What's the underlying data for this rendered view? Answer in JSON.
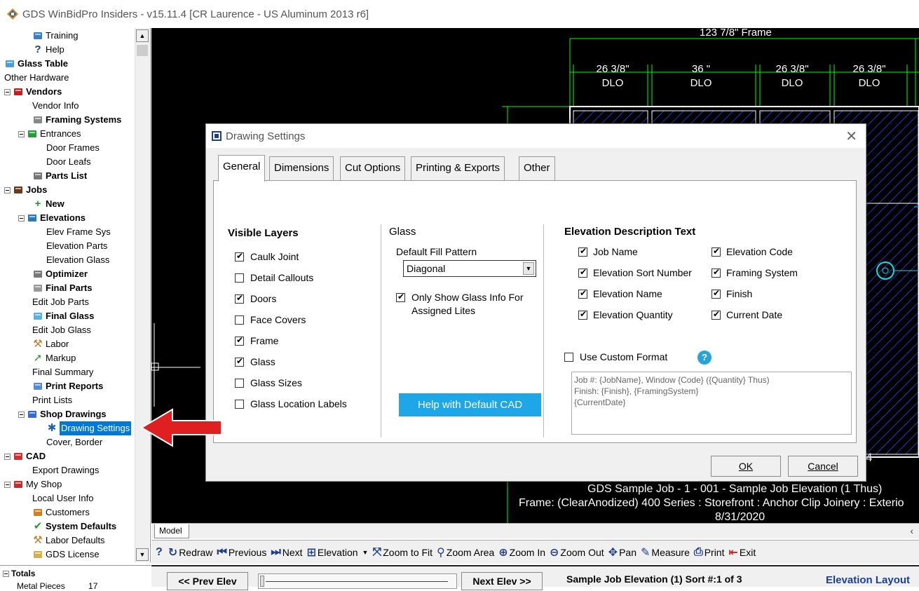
{
  "window": {
    "title": "GDS WinBidPro Insiders - v15.11.4  [CR Laurence - US Aluminum 2013 r6]"
  },
  "tree": {
    "items": [
      {
        "label": "Training",
        "bold": false,
        "icon": "training-icon"
      },
      {
        "label": "Help",
        "bold": false,
        "icon": "help-icon"
      },
      {
        "label": "Glass Table",
        "bold": true,
        "icon": "glass-table-icon"
      },
      {
        "label": "Other Hardware",
        "bold": false,
        "icon": ""
      },
      {
        "label": "Vendors",
        "bold": true,
        "icon": "vendors-icon"
      },
      {
        "label": "Vendor Info",
        "bold": false,
        "icon": ""
      },
      {
        "label": "Framing Systems",
        "bold": true,
        "icon": "framing-systems-icon"
      },
      {
        "label": "Entrances",
        "bold": false,
        "icon": "entrances-icon"
      },
      {
        "label": "Door Frames",
        "bold": false,
        "icon": ""
      },
      {
        "label": "Door Leafs",
        "bold": false,
        "icon": ""
      },
      {
        "label": "Parts List",
        "bold": true,
        "icon": "parts-list-icon"
      },
      {
        "label": "Jobs",
        "bold": true,
        "icon": "jobs-icon"
      },
      {
        "label": "New",
        "bold": true,
        "icon": "new-icon"
      },
      {
        "label": "Elevations",
        "bold": true,
        "icon": "elevations-icon"
      },
      {
        "label": "Elev Frame Sys",
        "bold": false,
        "icon": ""
      },
      {
        "label": "Elevation Parts",
        "bold": false,
        "icon": ""
      },
      {
        "label": "Elevation Glass",
        "bold": false,
        "icon": ""
      },
      {
        "label": "Optimizer",
        "bold": true,
        "icon": "optimizer-icon"
      },
      {
        "label": "Final Parts",
        "bold": true,
        "icon": "final-parts-icon"
      },
      {
        "label": "Edit Job Parts",
        "bold": false,
        "icon": ""
      },
      {
        "label": "Final Glass",
        "bold": true,
        "icon": "final-glass-icon"
      },
      {
        "label": "Edit Job Glass",
        "bold": false,
        "icon": ""
      },
      {
        "label": "Labor",
        "bold": false,
        "icon": "labor-icon"
      },
      {
        "label": "Markup",
        "bold": false,
        "icon": "markup-icon"
      },
      {
        "label": "Final Summary",
        "bold": false,
        "icon": ""
      },
      {
        "label": "Print Reports",
        "bold": true,
        "icon": "print-reports-icon"
      },
      {
        "label": "Print Lists",
        "bold": false,
        "icon": ""
      },
      {
        "label": "Shop Drawings",
        "bold": true,
        "icon": "shop-drawings-icon"
      },
      {
        "label": "Drawing Settings",
        "bold": false,
        "icon": "gear-icon",
        "selected": true
      },
      {
        "label": "Cover, Border",
        "bold": false,
        "icon": ""
      },
      {
        "label": "CAD",
        "bold": true,
        "icon": "cad-icon"
      },
      {
        "label": "Export Drawings",
        "bold": false,
        "icon": ""
      },
      {
        "label": "My Shop",
        "bold": false,
        "icon": "my-shop-icon"
      },
      {
        "label": "Local User Info",
        "bold": false,
        "icon": ""
      },
      {
        "label": "Customers",
        "bold": false,
        "icon": "customers-icon"
      },
      {
        "label": "System Defaults",
        "bold": true,
        "icon": "checkmark-icon"
      },
      {
        "label": "Labor Defaults",
        "bold": false,
        "icon": "labor-defaults-icon"
      },
      {
        "label": "GDS License",
        "bold": false,
        "icon": "license-icon"
      }
    ],
    "totals_label": "Totals",
    "totals_row_label": "Metal Pieces",
    "totals_row_value": "17"
  },
  "cad": {
    "frame_dim": "123 7/8\" Frame",
    "dlo": [
      {
        "dim": "26 3/8\"",
        "label": "DLO"
      },
      {
        "dim": "36 \"",
        "label": "DLO"
      },
      {
        "dim": "26 3/8\"",
        "label": "DLO"
      },
      {
        "dim": "26 3/8\"",
        "label": "DLO"
      }
    ],
    "right_digit": "4",
    "desc_line1": "GDS Sample Job - 1 - 001 - Sample Job Elevation (1 Thus)",
    "desc_line2": "Frame: (ClearAnodized) 400 Series : Storefront : Anchor Clip Joinery : Exterio",
    "desc_line3": "8/31/2020"
  },
  "model_tab": "Model",
  "toolbar": {
    "help": "?",
    "redraw": "Redraw",
    "previous": "Previous",
    "next": "Next",
    "elevation": "Elevation",
    "zoom_fit": "Zoom to Fit",
    "zoom_area": "Zoom Area",
    "zoom_in": "Zoom In",
    "zoom_out": "Zoom Out",
    "pan": "Pan",
    "measure": "Measure",
    "print": "Print",
    "exit": "Exit"
  },
  "navbar": {
    "prev": "<< Prev Elev",
    "next": "Next Elev >>",
    "status": "Sample Job Elevation (1) Sort #:1  of 3",
    "layout": "Elevation  Layout"
  },
  "dialog": {
    "title": "Drawing Settings",
    "tabs": [
      "General",
      "Dimensions",
      "Cut Options",
      "Printing & Exports",
      "Other"
    ],
    "visible_layers_title": "Visible Layers",
    "layers": [
      {
        "label": "Caulk Joint",
        "checked": true
      },
      {
        "label": "Detail Callouts",
        "checked": false
      },
      {
        "label": "Doors",
        "checked": true
      },
      {
        "label": "Face Covers",
        "checked": false
      },
      {
        "label": "Frame",
        "checked": true
      },
      {
        "label": "Glass",
        "checked": true
      },
      {
        "label": "Glass Sizes",
        "checked": false
      },
      {
        "label": "Glass Location Labels",
        "checked": false
      }
    ],
    "glass_title": "Glass",
    "fill_label": "Default Fill Pattern",
    "fill_value": "Diagonal",
    "only_show_label_1": "Only Show Glass Info For",
    "only_show_label_2": "Assigned Lites",
    "only_show_checked": true,
    "help_button": "Help with Default CAD",
    "desc_title": "Elevation Description Text",
    "desc_left": [
      {
        "label": "Job Name",
        "checked": true
      },
      {
        "label": "Elevation Sort Number",
        "checked": true
      },
      {
        "label": "Elevation Name",
        "checked": true
      },
      {
        "label": "Elevation Quantity",
        "checked": true
      }
    ],
    "desc_right": [
      {
        "label": "Elevation Code",
        "checked": true
      },
      {
        "label": "Framing System",
        "checked": true
      },
      {
        "label": "Finish",
        "checked": true
      },
      {
        "label": "Current Date",
        "checked": true
      }
    ],
    "custom_format_label": "Use Custom Format",
    "custom_format_checked": false,
    "custom_format_text": "Job #: {JobName}, Window {Code} ({Quantity} Thus)\nFinish: {Finish}, {FramingSystem}\n{CurrentDate}",
    "ok": "OK",
    "cancel": "Cancel"
  },
  "colors": {
    "selection": "#0078d7",
    "help_button": "#1ea7e8",
    "arrow": "#e02020",
    "cad_green": "#00ff00",
    "cad_frame": "#ffffff",
    "cad_hatch": "#3030c8",
    "cad_cyan": "#00e5e5"
  }
}
